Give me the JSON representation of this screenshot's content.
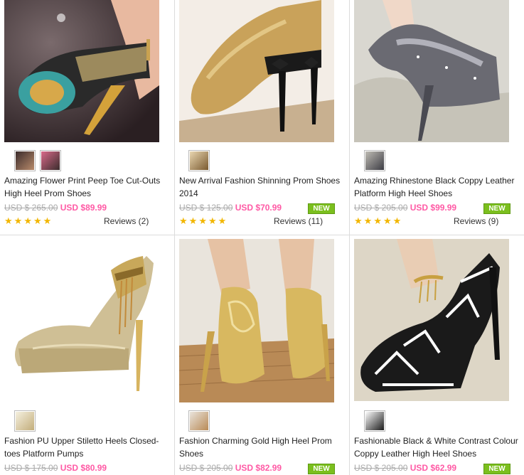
{
  "products": [
    {
      "title": "Amazing Flower Print Peep Toe Cut-Outs High Heel Prom Shoes",
      "old_price": "USD $ 265.00",
      "price": "USD $89.99",
      "badge": "",
      "reviews": "Reviews (2)",
      "rating": 5
    },
    {
      "title": "New Arrival Fashion Shinning Prom Shoes 2014",
      "old_price": "USD $ 125.00",
      "price": "USD $70.99",
      "badge": "NEW",
      "reviews": "Reviews (11)",
      "rating": 5
    },
    {
      "title": "Amazing Rhinestone Black Coppy Leather Platform High Heel Shoes",
      "old_price": "USD $ 205.00",
      "price": "USD $99.99",
      "badge": "NEW",
      "reviews": "Reviews (9)",
      "rating": 5
    },
    {
      "title": "Fashion PU Upper Stiletto Heels Closed-toes Platform Pumps",
      "old_price": "USD $ 175.00",
      "price": "USD $80.99",
      "badge": ""
    },
    {
      "title": "Fashion Charming Gold High Heel Prom Shoes",
      "old_price": "USD $ 205.00",
      "price": "USD $82.99",
      "badge": "NEW"
    },
    {
      "title": "Fashionable Black & White Contrast Colour Coppy Leather High Heel Shoes",
      "old_price": "USD $ 205.00",
      "price": "USD $62.99",
      "badge": "NEW"
    }
  ],
  "colors": {
    "price": "#ff5aa5",
    "old_price": "#aaaaaa",
    "badge": "#7bbf1e",
    "star": "#f2b600",
    "border": "#dcdcdc"
  }
}
